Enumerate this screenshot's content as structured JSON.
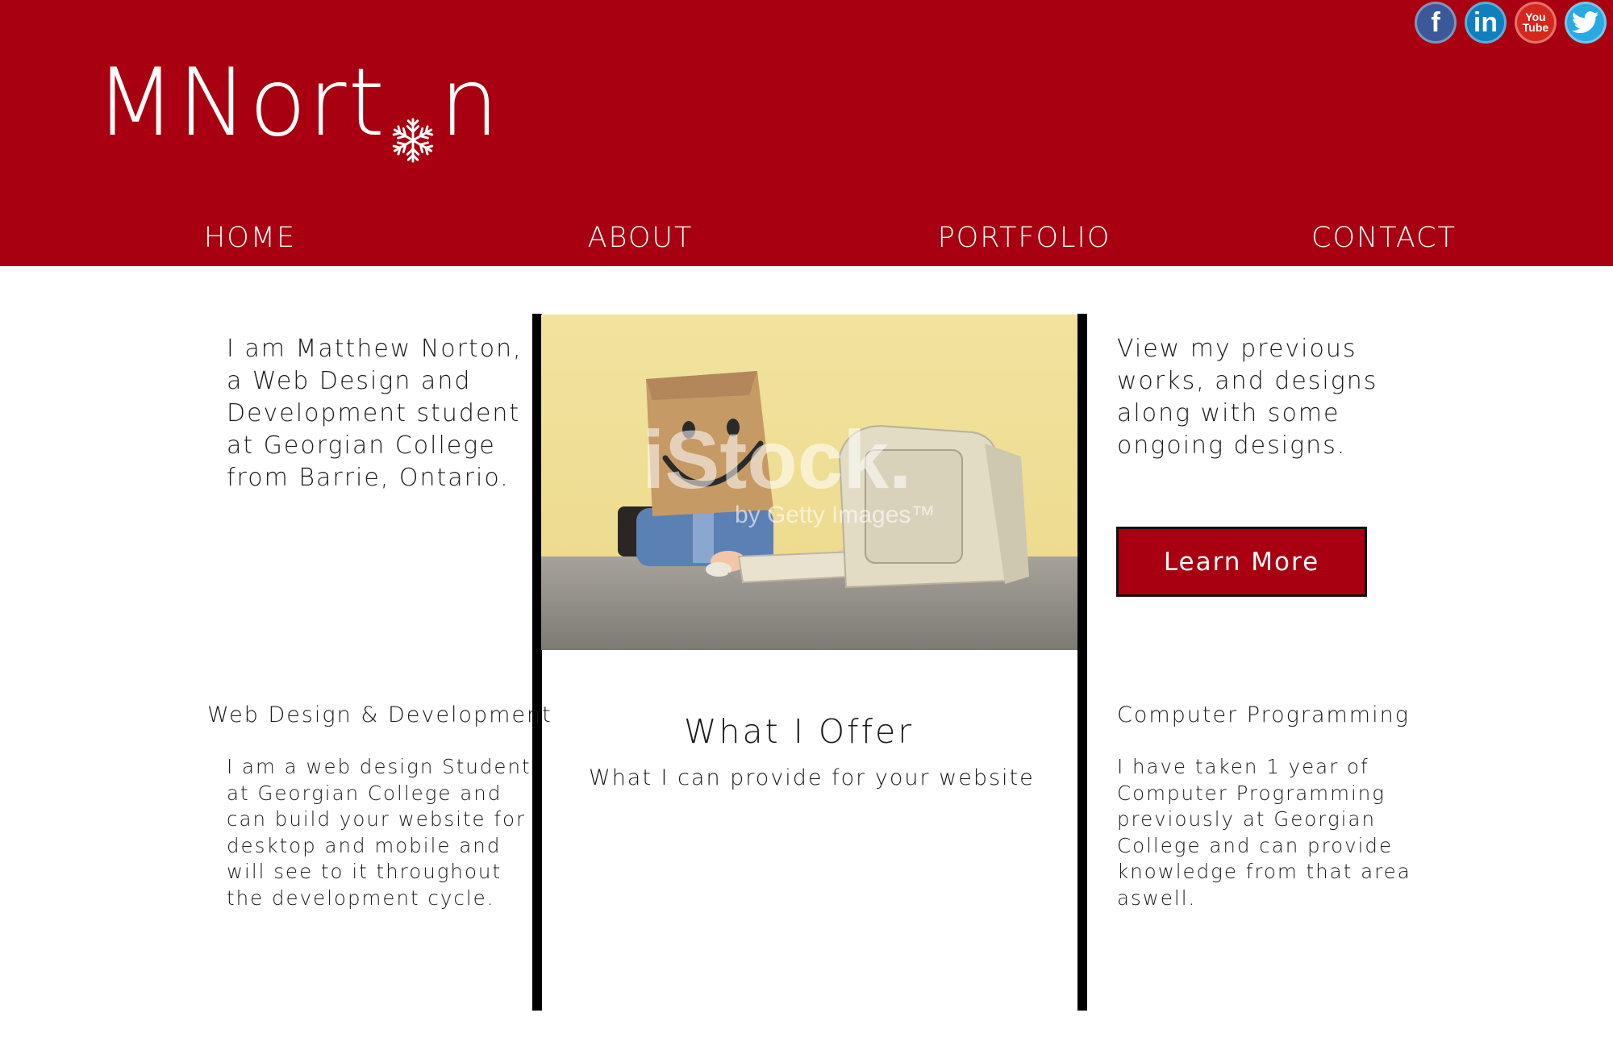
{
  "brand": {
    "logo_pre": "MNort",
    "logo_post": "n",
    "accent": "#a80010"
  },
  "social": [
    {
      "name": "facebook-icon",
      "glyph": "f",
      "color": "#3b5998"
    },
    {
      "name": "linkedin-icon",
      "glyph": "in",
      "color": "#0f7fbd"
    },
    {
      "name": "youtube-icon",
      "glyph_top": "You",
      "glyph_bottom": "Tube",
      "color": "#d4281f"
    },
    {
      "name": "twitter-icon",
      "color": "#29a9e1"
    }
  ],
  "nav": [
    "HOME",
    "ABOUT",
    "PORTFOLIO",
    "CONTACT"
  ],
  "intro": "I am Matthew Norton,\na Web Design and\nDevelopment student\nat Georgian College\nfrom Barrie, Ontario.",
  "view": "View my previous\nworks, and designs\nalong with some\nongoing designs.",
  "learn_more": "Learn More",
  "photo": {
    "watermark_main": "iStock.",
    "watermark_sub": "by Getty Images™"
  },
  "offer": {
    "title": "What I Offer",
    "subtitle": "What I can provide for your website"
  },
  "left": {
    "heading": "Web Design & Development",
    "body": "I am a web design Student\nat Georgian College and\ncan build your website for\ndesktop and mobile and\nwill see to it throughout\nthe development cycle."
  },
  "right": {
    "heading": "Computer Programming",
    "body": "I have taken 1 year of\nComputer Programming\npreviously at Georgian\nCollege and can provide\nknowledge from that area\naswell."
  }
}
